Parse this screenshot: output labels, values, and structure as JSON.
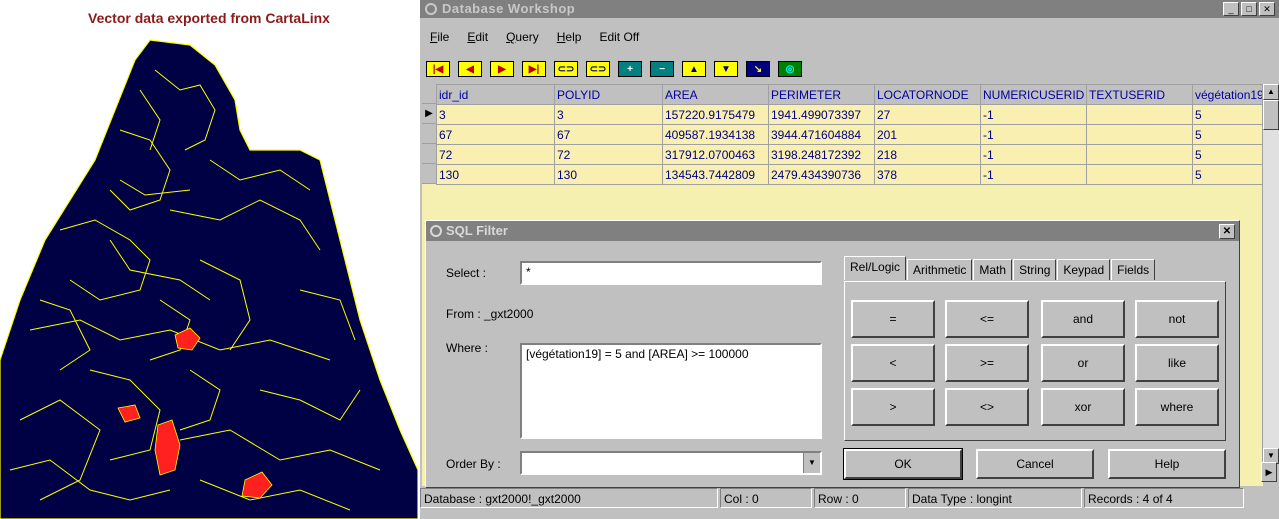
{
  "map": {
    "title": "Vector data exported from CartaLinx",
    "colors": {
      "background": "#000044",
      "lines": "#ffff00",
      "highlight": "#ff2020"
    }
  },
  "window": {
    "title": "Database Workshop",
    "controls": [
      "_",
      "□",
      "✕"
    ]
  },
  "menu": {
    "items": [
      "File",
      "Edit",
      "Query",
      "Help",
      "Edit Off"
    ]
  },
  "toolbar": {
    "buttons": [
      {
        "name": "first-record-icon",
        "glyph": "|◀"
      },
      {
        "name": "prev-record-icon",
        "glyph": "◀"
      },
      {
        "name": "next-record-icon",
        "glyph": "▶"
      },
      {
        "name": "last-record-icon",
        "glyph": "▶|"
      },
      {
        "name": "link-icon",
        "glyph": "⊂⊃"
      },
      {
        "name": "unlink-icon",
        "glyph": "⊂⊃"
      },
      {
        "name": "add-field-icon",
        "glyph": "+"
      },
      {
        "name": "remove-field-icon",
        "glyph": "−"
      },
      {
        "name": "sort-ascending-icon",
        "glyph": "▲"
      },
      {
        "name": "sort-descending-icon",
        "glyph": "▼"
      },
      {
        "name": "query-icon",
        "glyph": "↘"
      },
      {
        "name": "globe-icon",
        "glyph": "◎"
      }
    ]
  },
  "grid": {
    "columns": [
      "idr_id",
      "POLYID",
      "AREA",
      "PERIMETER",
      "LOCATORNODE",
      "NUMERICUSERID",
      "TEXTUSERID",
      "végétation19"
    ],
    "rows": [
      [
        "3",
        "3",
        "157220.9175479",
        "1941.499073397",
        "27",
        "-1",
        "",
        "5"
      ],
      [
        "67",
        "67",
        "409587.1934138",
        "3944.471604884",
        "201",
        "-1",
        "",
        "5"
      ],
      [
        "72",
        "72",
        "317912.0700463",
        "3198.248172392",
        "218",
        "-1",
        "",
        "5"
      ],
      [
        "130",
        "130",
        "134543.7442809",
        "2479.434390736",
        "378",
        "-1",
        "",
        "5"
      ]
    ]
  },
  "sql": {
    "title": "SQL Filter",
    "close": "✕",
    "select_label": "Select :",
    "select_value": "*",
    "from_label": "From :  _gxt2000",
    "where_label": "Where :",
    "where_value": "[végétation19] = 5 and [AREA] >= 100000",
    "orderby_label": "Order By :",
    "orderby_value": "",
    "tabs": [
      "Rel/Logic",
      "Arithmetic",
      "Math",
      "String",
      "Keypad",
      "Fields"
    ],
    "operators": [
      "=",
      "<=",
      "and",
      "not",
      "<",
      ">=",
      "or",
      "like",
      ">",
      "<>",
      "xor",
      "where"
    ],
    "ok": "OK",
    "cancel": "Cancel",
    "help": "Help"
  },
  "status": {
    "database": "Database : gxt2000!_gxt2000",
    "col": "Col : 0",
    "row": "Row : 0",
    "datatype": "Data Type : longint",
    "records": "Records : 4 of 4"
  }
}
